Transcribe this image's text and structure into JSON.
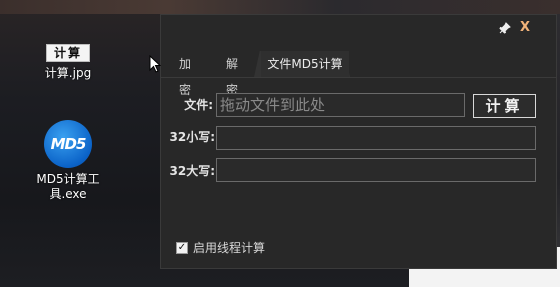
{
  "desktop": {
    "icons": [
      {
        "thumb_text": "计算",
        "label": "计算.jpg"
      },
      {
        "badge": "MD5",
        "label_line1": "MD5计算工",
        "label_line2": "具.exe"
      }
    ]
  },
  "window": {
    "pin_symbol": "📌",
    "close_symbol": "X",
    "tabs": [
      {
        "label": "加密"
      },
      {
        "label": "解密"
      },
      {
        "label": "文件MD5计算",
        "active": true
      }
    ],
    "form": {
      "file_label": "文件:",
      "file_placeholder": "拖动文件到此处",
      "calc_button": "计算",
      "lower_label": "32小写:",
      "lower_value": "",
      "upper_label": "32大写:",
      "upper_value": ""
    },
    "option": {
      "label": "启用线程计算",
      "checked": true,
      "check_mark": "✓"
    }
  },
  "colors": {
    "window_bg": "#282828",
    "accent_close": "#f1b37a",
    "md5_blue": "#0b63c8"
  }
}
